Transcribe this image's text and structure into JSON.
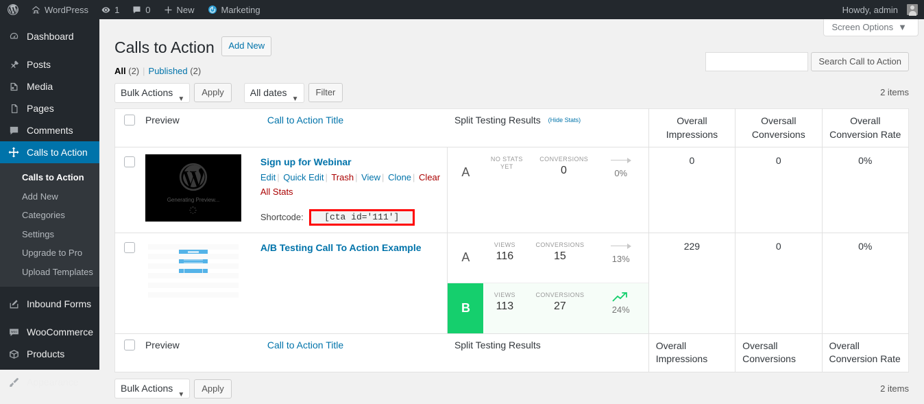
{
  "adminbar": {
    "logo_icon": "wordpress-logo-icon",
    "site_name": "WordPress",
    "site_icon": "home-icon",
    "updates_icon": "updates-icon",
    "updates_count": "1",
    "comments_icon": "comment-bubble-icon",
    "comments_count": "0",
    "new_icon": "plus-icon",
    "new_label": "New",
    "marketing_icon": "power-circle-icon",
    "marketing_label": "Marketing",
    "howdy": "Howdy, admin",
    "avatar_icon": "avatar-icon"
  },
  "sidebar": {
    "items": [
      {
        "label": "Dashboard",
        "icon": "dashboard-gauge-icon",
        "active": false
      },
      {
        "label": "Posts",
        "icon": "pin-icon",
        "active": false
      },
      {
        "label": "Media",
        "icon": "media-icon",
        "active": false
      },
      {
        "label": "Pages",
        "icon": "pages-icon",
        "active": false
      },
      {
        "label": "Comments",
        "icon": "comment-bubble-icon",
        "active": false
      },
      {
        "label": "Calls to Action",
        "icon": "move-arrows-icon",
        "active": true
      }
    ],
    "submenu": [
      {
        "label": "Calls to Action",
        "current": true
      },
      {
        "label": "Add New",
        "current": false
      },
      {
        "label": "Categories",
        "current": false
      },
      {
        "label": "Settings",
        "current": false
      },
      {
        "label": "Upgrade to Pro",
        "current": false
      },
      {
        "label": "Upload Templates",
        "current": false
      }
    ],
    "items_after": [
      {
        "label": "Inbound Forms",
        "icon": "pencil-square-icon"
      },
      {
        "label": "WooCommerce",
        "icon": "woo-icon"
      },
      {
        "label": "Products",
        "icon": "box-icon"
      },
      {
        "label": "Appearance",
        "icon": "paintbrush-icon"
      }
    ]
  },
  "screen_options": {
    "label": "Screen Options",
    "caret": "▼"
  },
  "page": {
    "title": "Calls to Action",
    "add_new": "Add New"
  },
  "views": {
    "all_label": "All",
    "all_count": "(2)",
    "separator": "|",
    "published_label": "Published",
    "published_count": "(2)"
  },
  "search": {
    "value": "",
    "placeholder": "",
    "button": "Search Call to Action"
  },
  "tablenav_top": {
    "bulk_actions": "Bulk Actions",
    "caret": "▼",
    "apply": "Apply",
    "dates": "All dates",
    "filter": "Filter",
    "items": "2 items"
  },
  "tablenav_bottom": {
    "bulk_actions": "Bulk Actions",
    "caret": "▼",
    "apply": "Apply",
    "items": "2 items"
  },
  "table": {
    "head": {
      "preview": "Preview",
      "title": "Call to Action Title",
      "split": "Split Testing Results",
      "hide_stats": "(Hide Stats)",
      "impressions_l1": "Overall",
      "impressions_l2": "Impressions",
      "conversions_l1": "Oversall",
      "conversions_l2": "Conversions",
      "rate_l1": "Overall",
      "rate_l2": "Conversion Rate"
    },
    "foot": {
      "preview": "Preview",
      "title": "Call to Action Title",
      "split": "Split Testing Results",
      "impressions_l1": "Overall",
      "impressions_l2": "Impressions",
      "conversions_l1": "Oversall",
      "conversions_l2": "Conversions",
      "rate_l1": "Overall",
      "rate_l2": "Conversion Rate"
    },
    "rows": [
      {
        "title": "Sign up for Webinar",
        "thumb_type": "generating",
        "thumb_text": "Generating Preview...",
        "actions": [
          {
            "label": "Edit",
            "danger": false
          },
          {
            "label": "Quick Edit",
            "danger": false
          },
          {
            "label": "Trash",
            "danger": true
          },
          {
            "label": "View",
            "danger": false
          },
          {
            "label": "Clone",
            "danger": false
          },
          {
            "label": "Clear All Stats",
            "danger": true
          }
        ],
        "shortcode_label": "Shortcode:",
        "shortcode_value": "[cta id='111']",
        "variants": [
          {
            "letter": "A",
            "winner": false,
            "views_label": "No stats yet",
            "views_value": "",
            "conv_label": "Conversions",
            "conv_value": "0",
            "trend": "flat",
            "pct": "0%"
          }
        ],
        "impressions": "0",
        "conversions": "0",
        "rate": "0%"
      },
      {
        "title": "A/B Testing Call To Action Example",
        "thumb_type": "cta-preview",
        "thumb_text": "",
        "actions": [],
        "shortcode_label": "",
        "shortcode_value": "",
        "variants": [
          {
            "letter": "A",
            "winner": false,
            "views_label": "Views",
            "views_value": "116",
            "conv_label": "Conversions",
            "conv_value": "15",
            "trend": "flat",
            "pct": "13%"
          },
          {
            "letter": "B",
            "winner": true,
            "views_label": "Views",
            "views_value": "113",
            "conv_label": "Conversions",
            "conv_value": "27",
            "trend": "up",
            "pct": "24%"
          }
        ],
        "impressions": "229",
        "conversions": "0",
        "rate": "0%"
      }
    ]
  },
  "colors": {
    "admin_bg": "#23282d",
    "accent_blue": "#0073aa",
    "link": "#0073aa",
    "danger": "#a00",
    "winner_green": "#15cf6d",
    "shortcode_border": "#ff0000"
  }
}
